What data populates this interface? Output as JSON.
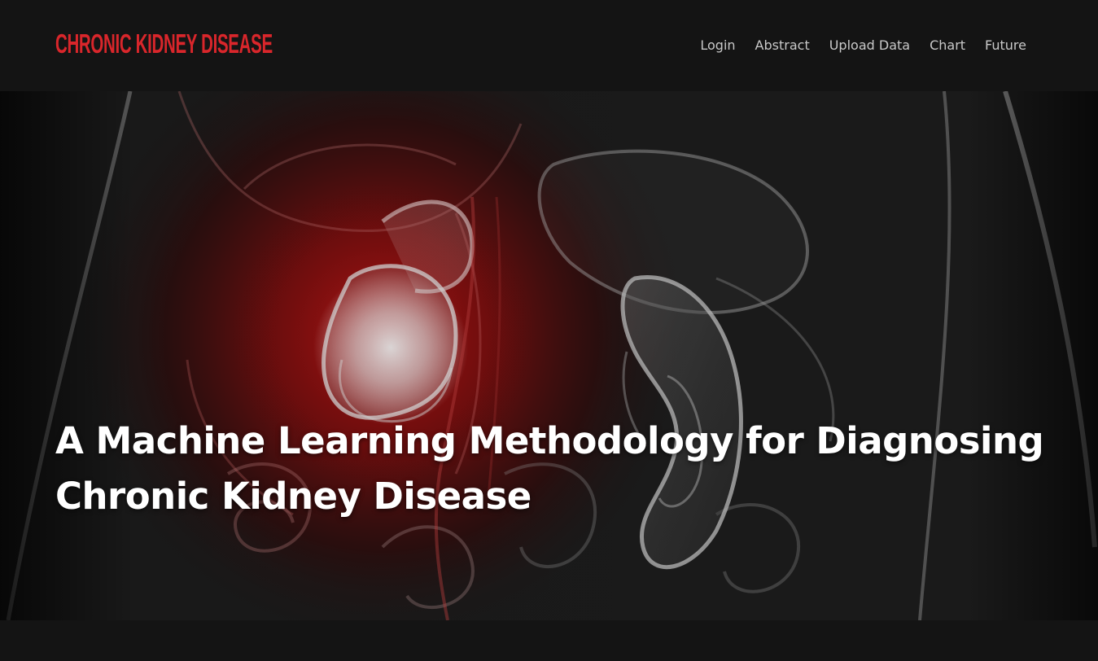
{
  "header": {
    "brand": "CHRONIC KIDNEY DISEASE",
    "nav": [
      {
        "label": "Login"
      },
      {
        "label": "Abstract"
      },
      {
        "label": "Upload Data"
      },
      {
        "label": "Chart"
      },
      {
        "label": "Future"
      }
    ]
  },
  "hero": {
    "title_line1": "A Machine Learning Methodology for Diagnosing",
    "title_line2": "Chronic Kidney Disease"
  },
  "colors": {
    "background": "#141414",
    "brand": "#d9262b",
    "nav_text": "#c9c9c9",
    "hero_text": "#ffffff",
    "accent_glow": "#c41010"
  },
  "icons": {
    "hero_image": "kidney-anatomy-illustration"
  }
}
